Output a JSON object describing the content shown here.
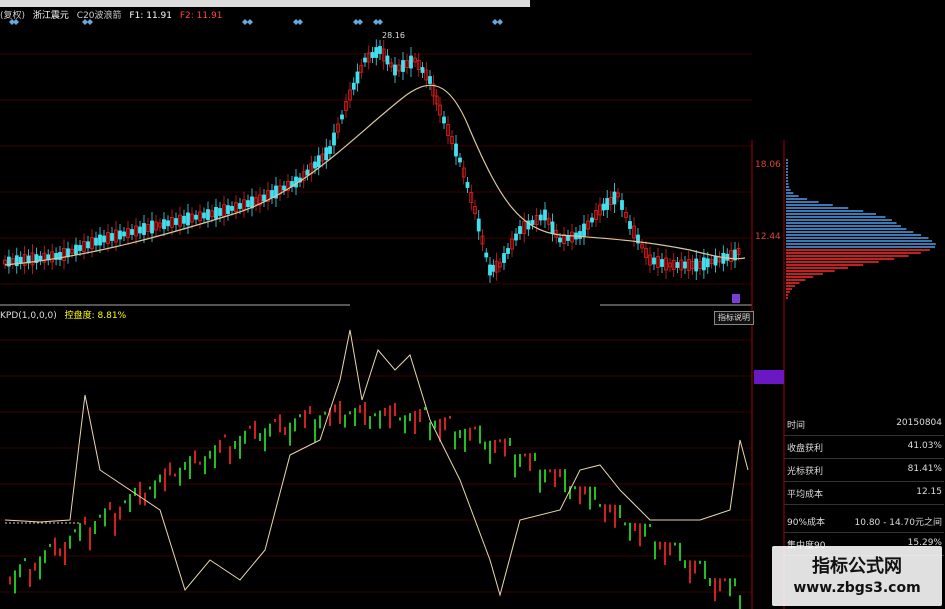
{
  "main_header": {
    "period": "(复权)",
    "stock_name": "浙江震元",
    "indicator": "C20波浪箭",
    "f1": "F1: 11.91",
    "f2": "F2: 11.91"
  },
  "peak_label": "28.16",
  "price_axis": {
    "upper": "18.06",
    "lower": "12.44"
  },
  "indicator_header": {
    "name": "KPD(1,0,0,0)",
    "label": "控盘度: 8.81%"
  },
  "help_button": "指标说明",
  "info_panel": [
    {
      "key": "时间",
      "value": "20150804"
    },
    {
      "key": "收盘获利",
      "value": "41.03%"
    },
    {
      "key": "光标获利",
      "value": "81.41%"
    },
    {
      "key": "平均成本",
      "value": "12.15"
    },
    {
      "key": "90%成本",
      "value": "10.80 - 14.70元之间"
    },
    {
      "key": "集中度90",
      "value": "15.29%"
    }
  ],
  "watermark": {
    "title": "指标公式网",
    "url": "www.zbgs3.com"
  },
  "colors": {
    "up": "#e02020",
    "down": "#40e0f0",
    "ma": "#d8c8a0",
    "indicator_line": "#e8d8b0",
    "green_bar": "#20c020",
    "red_bar": "#d02020"
  }
}
